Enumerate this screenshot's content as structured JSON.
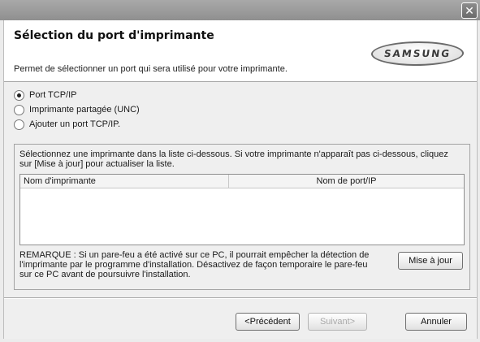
{
  "window": {
    "close_symbol": "✕"
  },
  "header": {
    "title": "Sélection du port d'imprimante",
    "subtitle": "Permet de sélectionner un port qui sera utilisé pour votre imprimante.",
    "logo_text": "SAMSUNG"
  },
  "options": [
    {
      "label": "Port TCP/IP",
      "selected": true
    },
    {
      "label": "Imprimante partagée (UNC)",
      "selected": false
    },
    {
      "label": "Ajouter un port TCP/IP.",
      "selected": false
    }
  ],
  "group": {
    "instructions": "Sélectionnez une imprimante dans la liste ci-dessous. Si votre imprimante n'apparaît pas ci-dessous, cliquez sur [Mise à jour] pour actualiser la liste.",
    "columns": [
      "Nom d'imprimante",
      "Nom de port/IP"
    ],
    "rows": [],
    "remark": "REMARQUE : Si un pare-feu a été activé sur ce PC, il pourrait empêcher la détection de l'imprimante par le programme d'installation. Désactivez de façon temporaire le pare-feu sur ce PC avant de poursuivre l'installation.",
    "update_button": "Mise à jour"
  },
  "footer": {
    "back_button": "<Précédent",
    "next_button": "Suivant>",
    "cancel_button": "Annuler"
  }
}
